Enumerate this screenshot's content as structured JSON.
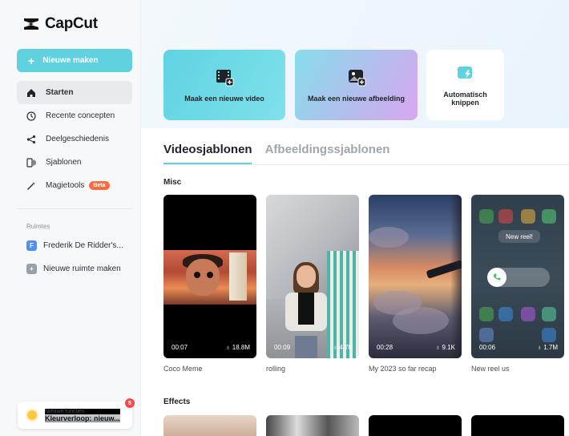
{
  "app": {
    "name": "CapCut"
  },
  "sidebar": {
    "new_button": "Nieuwe maken",
    "items": [
      {
        "label": "Starten",
        "icon": "home-icon"
      },
      {
        "label": "Recente concepten",
        "icon": "clock-icon"
      },
      {
        "label": "Deelgeschiedenis",
        "icon": "share-icon"
      },
      {
        "label": "Sjablonen",
        "icon": "template-icon"
      },
      {
        "label": "Magietools",
        "icon": "magic-wand-icon",
        "badge": "Beta"
      }
    ],
    "spaces_title": "Ruimtes",
    "spaces": [
      {
        "label": "Frederik De Ridder's...",
        "initial": "F",
        "color": "#4f8ff7"
      },
      {
        "label": "Nieuwe ruimte maken",
        "initial": "+",
        "color": "#9aa0a8"
      }
    ],
    "news": {
      "title": "Nieuwe functies",
      "subtitle": "Kleurverloop: nieuw...",
      "badge": "5"
    }
  },
  "quick_actions": [
    {
      "label": "Maak een nieuwe video",
      "icon": "video-add-icon"
    },
    {
      "label": "Maak een nieuwe afbeelding",
      "icon": "image-add-icon"
    },
    {
      "label": "Automatisch knippen",
      "icon": "auto-cut-icon"
    }
  ],
  "tabs": {
    "active": "Videosjablonen",
    "inactive": "Afbeeldingssjablonen"
  },
  "sections": {
    "misc": "Misc",
    "effects": "Effects"
  },
  "templates": [
    {
      "title": "Coco Meme",
      "duration": "00:07",
      "views": "18.8M"
    },
    {
      "title": "rolling",
      "duration": "00:09",
      "views": "4.7K"
    },
    {
      "title": "My 2023 so far recap",
      "duration": "00:28",
      "views": "9.1K"
    },
    {
      "title": "New reel us",
      "duration": "00:06",
      "views": "1.7M",
      "overlay": "New reel!"
    }
  ],
  "colors": {
    "accent": "#5fd1df",
    "beta": "#ff6a3d",
    "badge": "#f04b4b"
  }
}
